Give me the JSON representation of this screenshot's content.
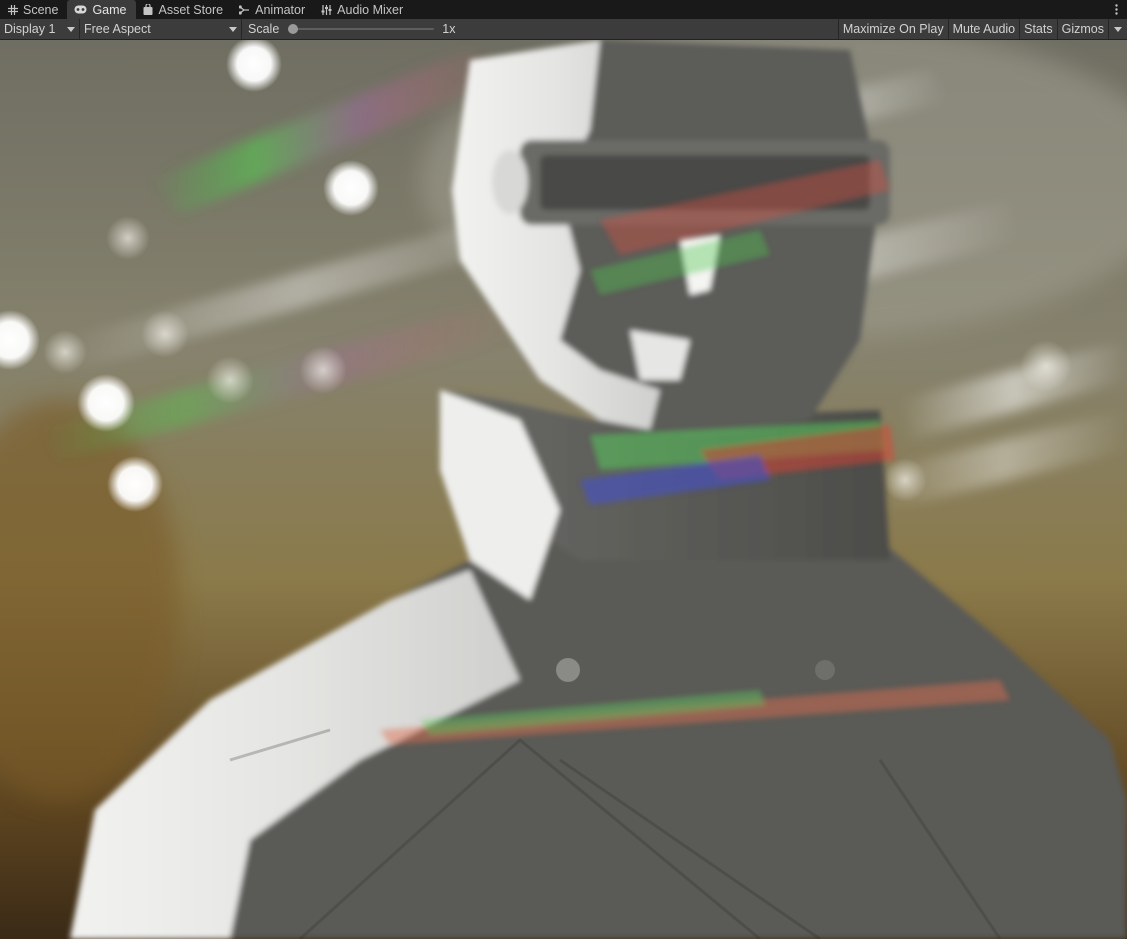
{
  "tabs": [
    {
      "label": "Scene",
      "icon": "grid-icon",
      "active": false
    },
    {
      "label": "Game",
      "icon": "gamepad-icon",
      "active": true
    },
    {
      "label": "Asset Store",
      "icon": "shopping-bag-icon",
      "active": false
    },
    {
      "label": "Animator",
      "icon": "animator-icon",
      "active": false
    },
    {
      "label": "Audio Mixer",
      "icon": "mixer-sliders-icon",
      "active": false
    }
  ],
  "toolbar": {
    "display_value": "Display 1",
    "aspect_value": "Free Aspect",
    "scale_label": "Scale",
    "scale_value": "1x",
    "scale_level": 0,
    "maximize_label": "Maximize On Play",
    "mute_label": "Mute Audio",
    "stats_label": "Stats",
    "gizmos_label": "Gizmos"
  },
  "colors": {
    "panel_bg": "#3c3c3c",
    "tabbar_bg": "#191919",
    "text": "#c4c4c4"
  }
}
